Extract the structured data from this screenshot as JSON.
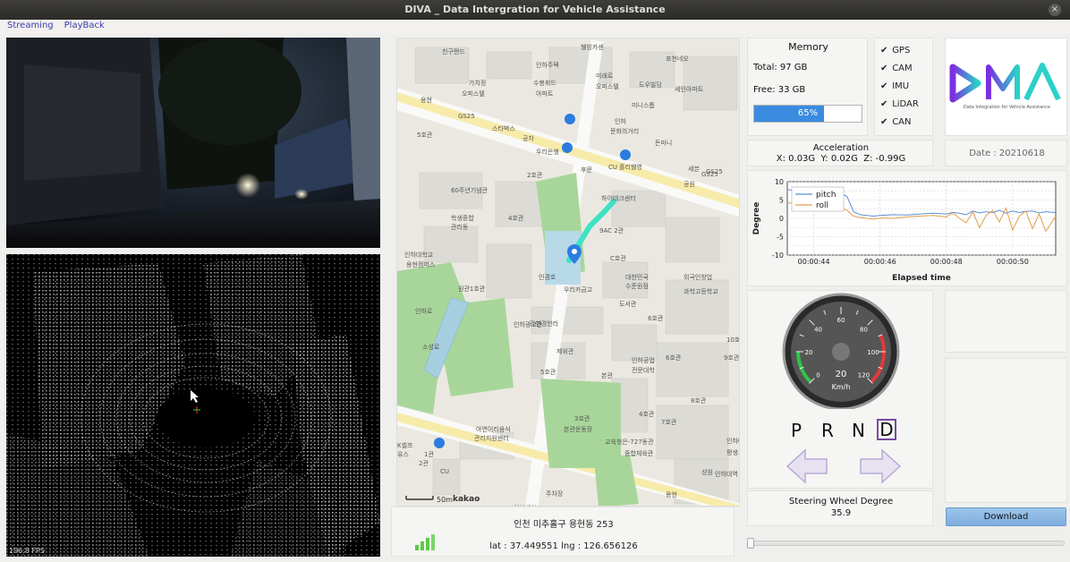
{
  "window": {
    "title": "DIVA _ Data Intergration for Vehicle Assistance",
    "close": "×"
  },
  "menu": {
    "items": [
      "Streaming",
      "PlayBack"
    ]
  },
  "lidar": {
    "fps": "196.8 FPS"
  },
  "map": {
    "address": "인천 미추홀구 용현동 253",
    "latlng": "lat : 37.449551 lng : 126.656126",
    "scale": "50m",
    "brand": "kakao",
    "labels": [
      {
        "t": "친구랜드"
      },
      {
        "t": "웰빙카센"
      },
      {
        "t": "인하주택"
      },
      {
        "t": "포천네오"
      },
      {
        "t": "가치정"
      },
      {
        "t": "오피스텔"
      },
      {
        "t": "수봉휘드"
      },
      {
        "t": "아파트"
      },
      {
        "t": "미래로"
      },
      {
        "t": "오피스텔"
      },
      {
        "t": "도우빌딩"
      },
      {
        "t": "세인아파트"
      },
      {
        "t": "미니스톱"
      },
      {
        "t": "인하"
      },
      {
        "t": "문화의거리"
      },
      {
        "t": "GS25"
      },
      {
        "t": "스타벅스"
      },
      {
        "t": "공차"
      },
      {
        "t": "5호관"
      },
      {
        "t": "우리은행"
      },
      {
        "t": "CU"
      },
      {
        "t": "홀리웰영"
      },
      {
        "t": "세븐"
      },
      {
        "t": "돈마니"
      },
      {
        "t": "GS25"
      },
      {
        "t": "2호관"
      },
      {
        "t": "후문"
      },
      {
        "t": "공원"
      },
      {
        "t": "GS25"
      },
      {
        "t": "60주년기념관"
      },
      {
        "t": "하이테크센터"
      },
      {
        "t": "학생종합"
      },
      {
        "t": "관리동"
      },
      {
        "t": "4호관"
      },
      {
        "t": "9AC 2관"
      },
      {
        "t": "인하대학교"
      },
      {
        "t": "용현캠퍼스"
      },
      {
        "t": "C호관"
      },
      {
        "t": "인경호"
      },
      {
        "t": "우리카금고"
      },
      {
        "t": "대한민국"
      },
      {
        "t": "수준원점"
      },
      {
        "t": "외국인창업"
      },
      {
        "t": "과학고등학교"
      },
      {
        "t": "원관1호관"
      },
      {
        "t": "도서관"
      },
      {
        "t": "6호관"
      },
      {
        "t": "인하광고관"
      },
      {
        "t": "강현경한라"
      },
      {
        "t": "제위관"
      },
      {
        "t": "본관"
      },
      {
        "t": "인하공업"
      },
      {
        "t": "전문대학"
      },
      {
        "t": "5호관"
      },
      {
        "t": "6호관"
      },
      {
        "t": "9호관"
      },
      {
        "t": "10호관"
      },
      {
        "t": "8호관"
      },
      {
        "t": "7호관"
      },
      {
        "t": "4호관"
      },
      {
        "t": "3호관"
      },
      {
        "t": "인하대"
      },
      {
        "t": "평생교육원"
      },
      {
        "t": "아연이리움식"
      },
      {
        "t": "관리지원센터"
      },
      {
        "t": "본관운동장"
      },
      {
        "t": "교육청은-727동관"
      },
      {
        "t": "종합체육관"
      },
      {
        "t": "K셀프"
      },
      {
        "t": "유스"
      },
      {
        "t": "CU"
      },
      {
        "t": "인하대역"
      },
      {
        "t": "주차장"
      },
      {
        "t": "용현"
      },
      {
        "t": "1관"
      },
      {
        "t": "2관"
      },
      {
        "t": "인하로"
      },
      {
        "t": "소성로"
      },
      {
        "t": "인하대학교"
      },
      {
        "t": "용현"
      },
      {
        "t": "성원"
      }
    ]
  },
  "memory": {
    "title": "Memory",
    "total": "Total: 97 GB",
    "free": "Free: 33 GB",
    "progress": 0.65,
    "progress_text": "65%"
  },
  "sensors": [
    {
      "label": "GPS",
      "checked": true
    },
    {
      "label": "CAM",
      "checked": true
    },
    {
      "label": "IMU",
      "checked": true
    },
    {
      "label": "LiDAR",
      "checked": true
    },
    {
      "label": "CAN",
      "checked": true
    }
  ],
  "logo": {
    "letters": "DMA",
    "tagline": "Data Integration for Vehicle Assistance"
  },
  "acceleration": {
    "title": "Acceleration",
    "values": "X: 0.03G  Y: 0.02G  Z: -0.99G"
  },
  "date": "Date : 20210618",
  "chart_data": {
    "type": "line",
    "title": "",
    "xlabel": "Elapsed time",
    "ylabel": "Degree",
    "ylim": [
      -10,
      10
    ],
    "yticks": [
      -10,
      -7.5,
      -5,
      -2.5,
      0,
      2.5,
      5,
      7.5,
      10
    ],
    "xticks": [
      "00:00:44",
      "00:00:46",
      "00:00:48",
      "00:00:50"
    ],
    "xtick_values": [
      44,
      46,
      48,
      50
    ],
    "xlim": [
      43.2,
      51.3
    ],
    "grid": true,
    "legend": "top-left",
    "series": [
      {
        "name": "pitch",
        "color": "#5b8fd4",
        "x": [
          43.2,
          43.6,
          44.0,
          44.4,
          44.8,
          45.0,
          45.2,
          45.4,
          45.6,
          45.8,
          46.0,
          46.4,
          46.8,
          47.2,
          47.6,
          48.0,
          48.2,
          48.4,
          48.6,
          48.8,
          49.0,
          49.2,
          49.4,
          49.6,
          49.8,
          50.0,
          50.2,
          50.4,
          50.6,
          50.8,
          51.0,
          51.3
        ],
        "values": [
          7.8,
          7.6,
          7.5,
          7.3,
          6.8,
          6.0,
          1.8,
          1.0,
          0.8,
          0.6,
          0.8,
          1.0,
          0.9,
          1.2,
          1.4,
          1.2,
          1.6,
          1.4,
          1.0,
          2.0,
          1.5,
          1.8,
          1.6,
          2.2,
          1.4,
          2.0,
          1.6,
          1.9,
          2.0,
          1.5,
          1.8,
          1.6
        ]
      },
      {
        "name": "roll",
        "color": "#e39d4b",
        "x": [
          43.2,
          43.6,
          44.0,
          44.4,
          44.8,
          45.0,
          45.2,
          45.4,
          45.6,
          45.8,
          46.0,
          46.4,
          46.8,
          47.2,
          47.6,
          48.0,
          48.2,
          48.4,
          48.6,
          48.8,
          49.0,
          49.2,
          49.4,
          49.6,
          49.8,
          50.0,
          50.2,
          50.4,
          50.6,
          50.8,
          51.0,
          51.3
        ],
        "values": [
          4.2,
          4.1,
          4.0,
          3.8,
          3.0,
          2.2,
          0.6,
          0.2,
          0.0,
          -0.2,
          0.1,
          0.0,
          0.4,
          0.6,
          0.8,
          0.4,
          1.5,
          0.0,
          -1.2,
          1.8,
          -2.5,
          0.8,
          2.2,
          -1.0,
          2.8,
          -3.2,
          0.6,
          2.0,
          -2.8,
          1.2,
          -3.5,
          0.5
        ]
      }
    ]
  },
  "speed": {
    "value": "20",
    "value_num": 20,
    "unit": "Km/h",
    "ticks": [
      "0",
      "20",
      "40",
      "60",
      "80",
      "100",
      "120"
    ],
    "max": 120
  },
  "gears": {
    "items": [
      "P",
      "R",
      "N",
      "D"
    ],
    "selected": "D"
  },
  "steering": {
    "title": "Steering Wheel Degree",
    "value": "35.9"
  },
  "download": {
    "label": "Download"
  },
  "colors": {
    "accent": "#4a90d9",
    "progress": "#3a8be0",
    "logo_purple": "#7c2ee0",
    "logo_cyan": "#2ad1c8",
    "route": "#3ee2c4",
    "pin": "#2b7de0",
    "gear_box": "#7a4aa0"
  }
}
